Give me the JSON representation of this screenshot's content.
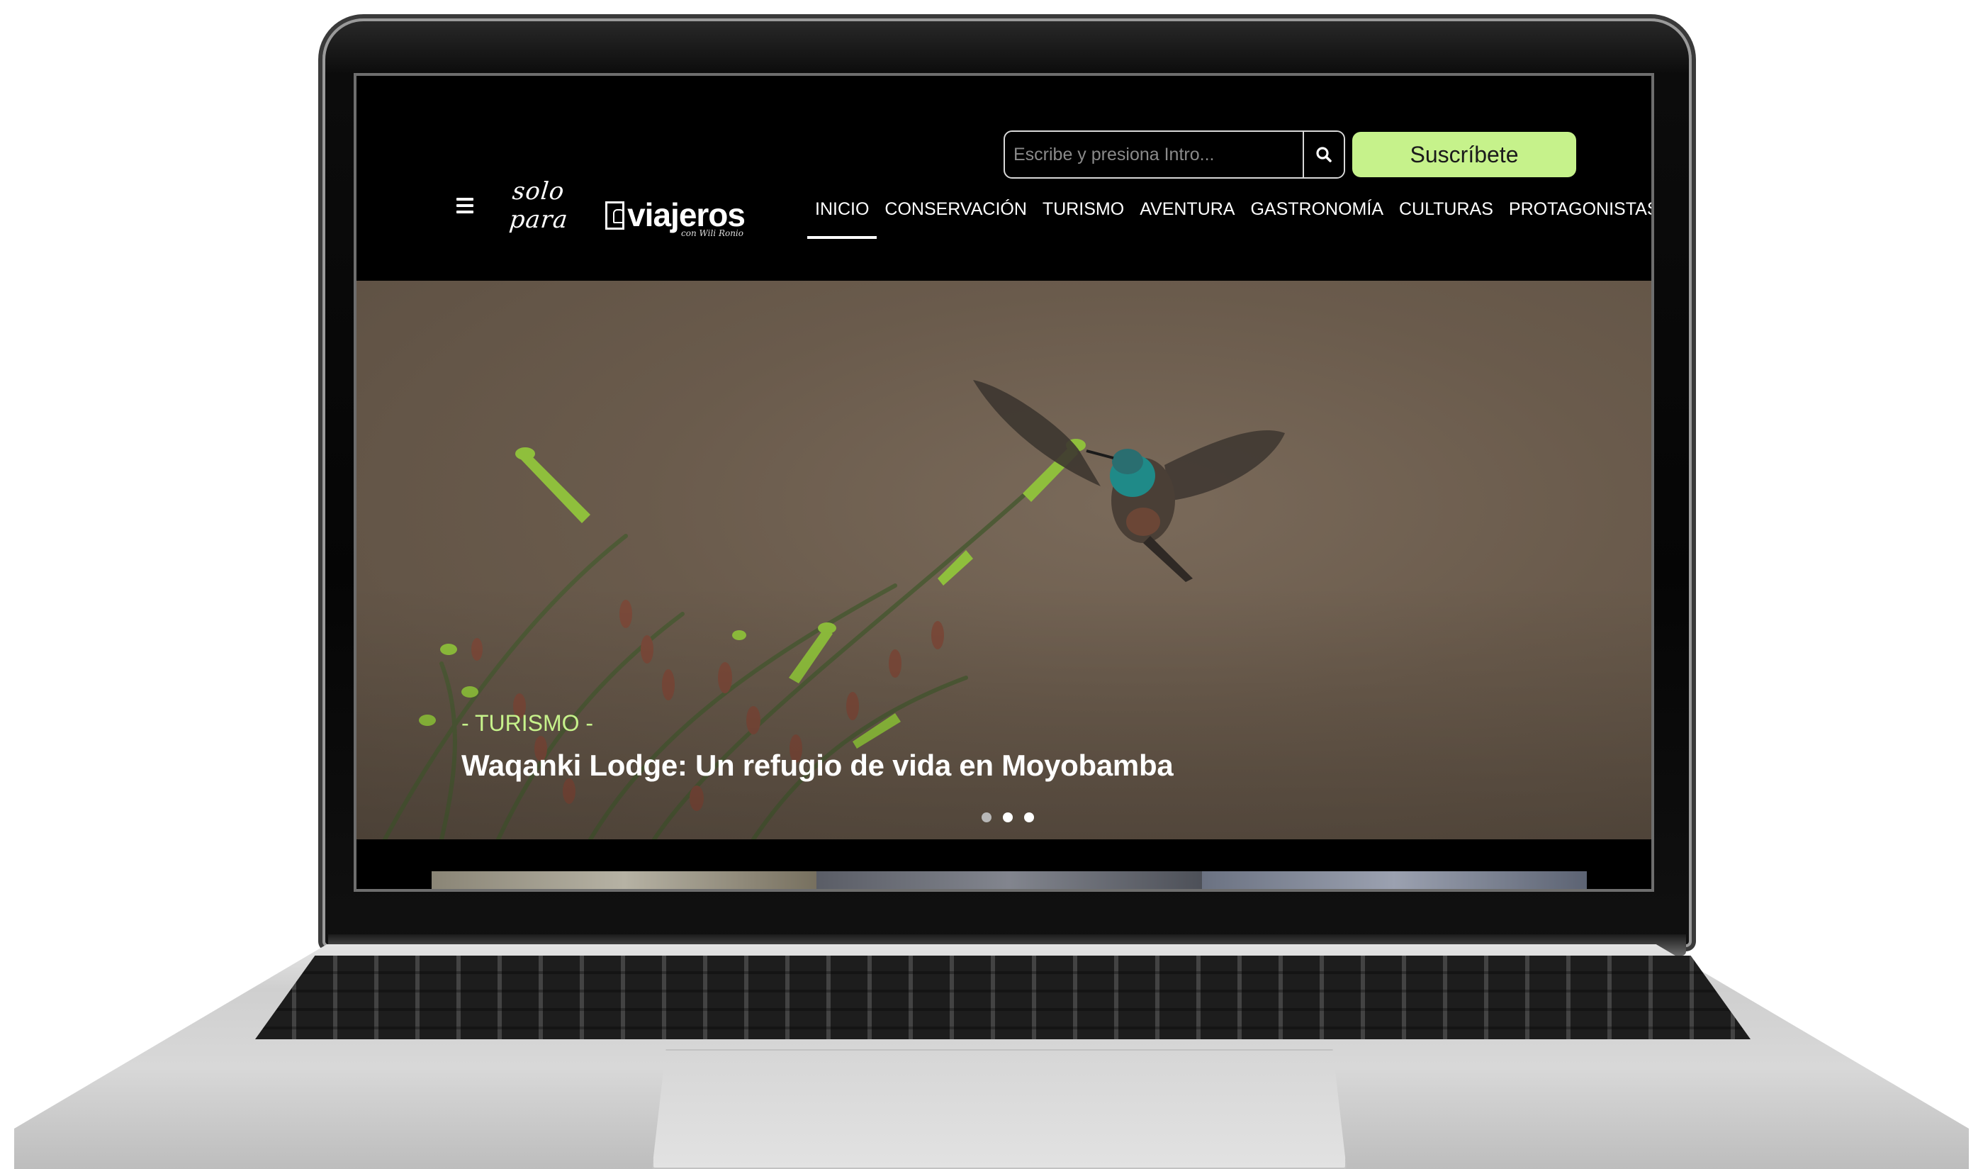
{
  "header": {
    "search": {
      "placeholder": "Escribe y presiona Intro..."
    },
    "subscribe_label": "Suscríbete",
    "logo": {
      "script_text": "solo para",
      "bold_text": "viajeros",
      "subtitle": "con Wili Ronio"
    }
  },
  "nav": {
    "items": [
      {
        "label": "INICIO",
        "active": true
      },
      {
        "label": "CONSERVACIÓN",
        "active": false
      },
      {
        "label": "TURISMO",
        "active": false
      },
      {
        "label": "AVENTURA",
        "active": false
      },
      {
        "label": "GASTRONOMÍA",
        "active": false
      },
      {
        "label": "CULTURAS",
        "active": false
      },
      {
        "label": "PROTAGONISTAS",
        "active": false
      }
    ]
  },
  "hero": {
    "category": "- TURISMO -",
    "title": "Waqanki Lodge: Un refugio de vida en Moyobamba",
    "slides_total": 3,
    "active_slide": 2,
    "image_subject": "hummingbird feeding from green tubular flowers"
  },
  "colors": {
    "accent": "#c6f28b",
    "header_bg": "#000000",
    "hero_bg": "#6a5b4c"
  },
  "icons": [
    "hamburger-menu-icon",
    "search-icon"
  ]
}
